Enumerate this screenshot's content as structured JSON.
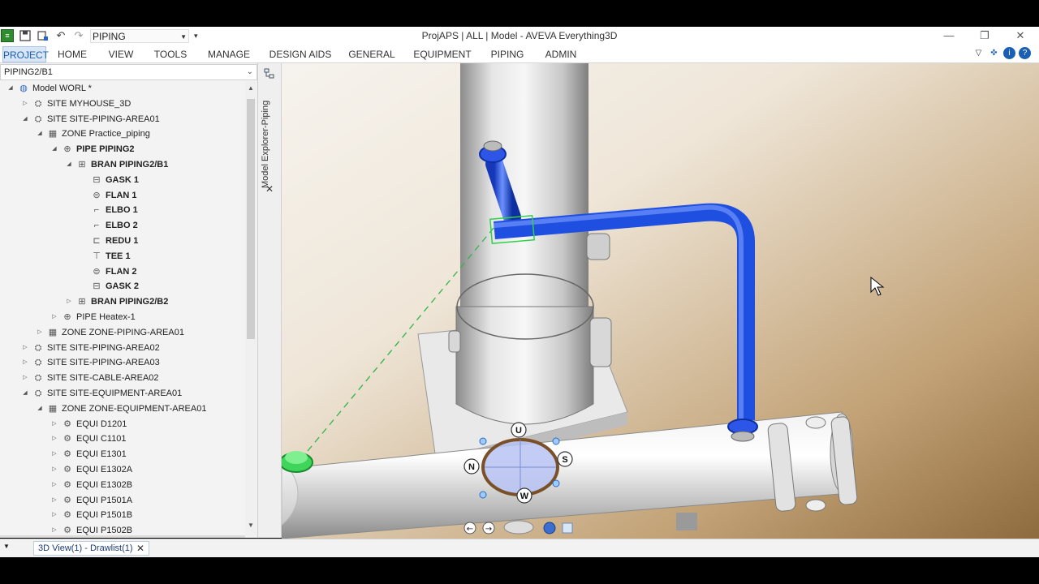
{
  "window": {
    "title": "ProjAPS | ALL | Model - AVEVA Everything3D",
    "module": "PIPING",
    "controls": {
      "minimize": "—",
      "restore": "❐",
      "close": "✕"
    }
  },
  "ribbon": {
    "tabs": [
      "PROJECT",
      "HOME",
      "VIEW",
      "TOOLS",
      "MANAGE",
      "DESIGN AIDS",
      "GENERAL",
      "EQUIPMENT",
      "PIPING",
      "ADMIN"
    ],
    "active_tab": "PROJECT"
  },
  "explorer": {
    "current_element": "PIPING2/B1",
    "panel_label": "Model Explorer-Piping",
    "tree": [
      {
        "label": "Model WORL *",
        "level": 0,
        "state": "expanded",
        "icon": "globe-icon",
        "bold": false
      },
      {
        "label": "SITE MYHOUSE_3D",
        "level": 1,
        "state": "collapsed",
        "icon": "site-icon",
        "bold": false
      },
      {
        "label": "SITE SITE-PIPING-AREA01",
        "level": 1,
        "state": "expanded",
        "icon": "site-icon",
        "bold": false
      },
      {
        "label": "ZONE Practice_piping",
        "level": 2,
        "state": "expanded",
        "icon": "zone-icon",
        "bold": false
      },
      {
        "label": "PIPE PIPING2",
        "level": 3,
        "state": "expanded",
        "icon": "pipe-icon",
        "bold": true
      },
      {
        "label": "BRAN PIPING2/B1",
        "level": 4,
        "state": "expanded",
        "icon": "branch-icon",
        "bold": true
      },
      {
        "label": "GASK 1",
        "level": 5,
        "state": "leaf",
        "icon": "gasket-icon",
        "bold": true
      },
      {
        "label": "FLAN 1",
        "level": 5,
        "state": "leaf",
        "icon": "flange-icon",
        "bold": true
      },
      {
        "label": "ELBO 1",
        "level": 5,
        "state": "leaf",
        "icon": "elbow-icon",
        "bold": true
      },
      {
        "label": "ELBO 2",
        "level": 5,
        "state": "leaf",
        "icon": "elbow-icon",
        "bold": true
      },
      {
        "label": "REDU 1",
        "level": 5,
        "state": "leaf",
        "icon": "reducer-icon",
        "bold": true
      },
      {
        "label": "TEE 1",
        "level": 5,
        "state": "leaf",
        "icon": "tee-icon",
        "bold": true
      },
      {
        "label": "FLAN 2",
        "level": 5,
        "state": "leaf",
        "icon": "flange-icon",
        "bold": true
      },
      {
        "label": "GASK 2",
        "level": 5,
        "state": "leaf",
        "icon": "gasket-icon",
        "bold": true
      },
      {
        "label": "BRAN PIPING2/B2",
        "level": 4,
        "state": "collapsed",
        "icon": "branch-icon",
        "bold": true
      },
      {
        "label": "PIPE Heatex-1",
        "level": 3,
        "state": "collapsed",
        "icon": "pipe-icon",
        "bold": false
      },
      {
        "label": "ZONE ZONE-PIPING-AREA01",
        "level": 2,
        "state": "collapsed",
        "icon": "zone-icon",
        "bold": false
      },
      {
        "label": "SITE SITE-PIPING-AREA02",
        "level": 1,
        "state": "collapsed",
        "icon": "site-icon",
        "bold": false
      },
      {
        "label": "SITE SITE-PIPING-AREA03",
        "level": 1,
        "state": "collapsed",
        "icon": "site-icon",
        "bold": false
      },
      {
        "label": "SITE SITE-CABLE-AREA02",
        "level": 1,
        "state": "collapsed",
        "icon": "site-icon",
        "bold": false
      },
      {
        "label": "SITE SITE-EQUIPMENT-AREA01",
        "level": 1,
        "state": "expanded",
        "icon": "site-icon",
        "bold": false
      },
      {
        "label": "ZONE ZONE-EQUIPMENT-AREA01",
        "level": 2,
        "state": "expanded",
        "icon": "zone-icon",
        "bold": false
      },
      {
        "label": "EQUI D1201",
        "level": 3,
        "state": "collapsed",
        "icon": "equipment-icon",
        "bold": false
      },
      {
        "label": "EQUI C1101",
        "level": 3,
        "state": "collapsed",
        "icon": "equipment-icon",
        "bold": false
      },
      {
        "label": "EQUI E1301",
        "level": 3,
        "state": "collapsed",
        "icon": "equipment-icon",
        "bold": false
      },
      {
        "label": "EQUI E1302A",
        "level": 3,
        "state": "collapsed",
        "icon": "equipment-icon",
        "bold": false
      },
      {
        "label": "EQUI E1302B",
        "level": 3,
        "state": "collapsed",
        "icon": "equipment-icon",
        "bold": false
      },
      {
        "label": "EQUI P1501A",
        "level": 3,
        "state": "collapsed",
        "icon": "equipment-icon",
        "bold": false
      },
      {
        "label": "EQUI P1501B",
        "level": 3,
        "state": "collapsed",
        "icon": "equipment-icon",
        "bold": false
      },
      {
        "label": "EQUI P1502B",
        "level": 3,
        "state": "collapsed",
        "icon": "equipment-icon",
        "bold": false
      }
    ]
  },
  "viewport": {
    "compass": {
      "up": "U",
      "north": "N",
      "south": "S",
      "west": "W"
    },
    "colors": {
      "background_top": "#f4f1ec",
      "background_bottom": "#96764a",
      "pipe": "#1f4fe0",
      "steel": "#c8c8c8",
      "highlight": "#2fd24a"
    }
  },
  "status": {
    "view_tab": "3D View(1) - Drawlist(1)"
  }
}
